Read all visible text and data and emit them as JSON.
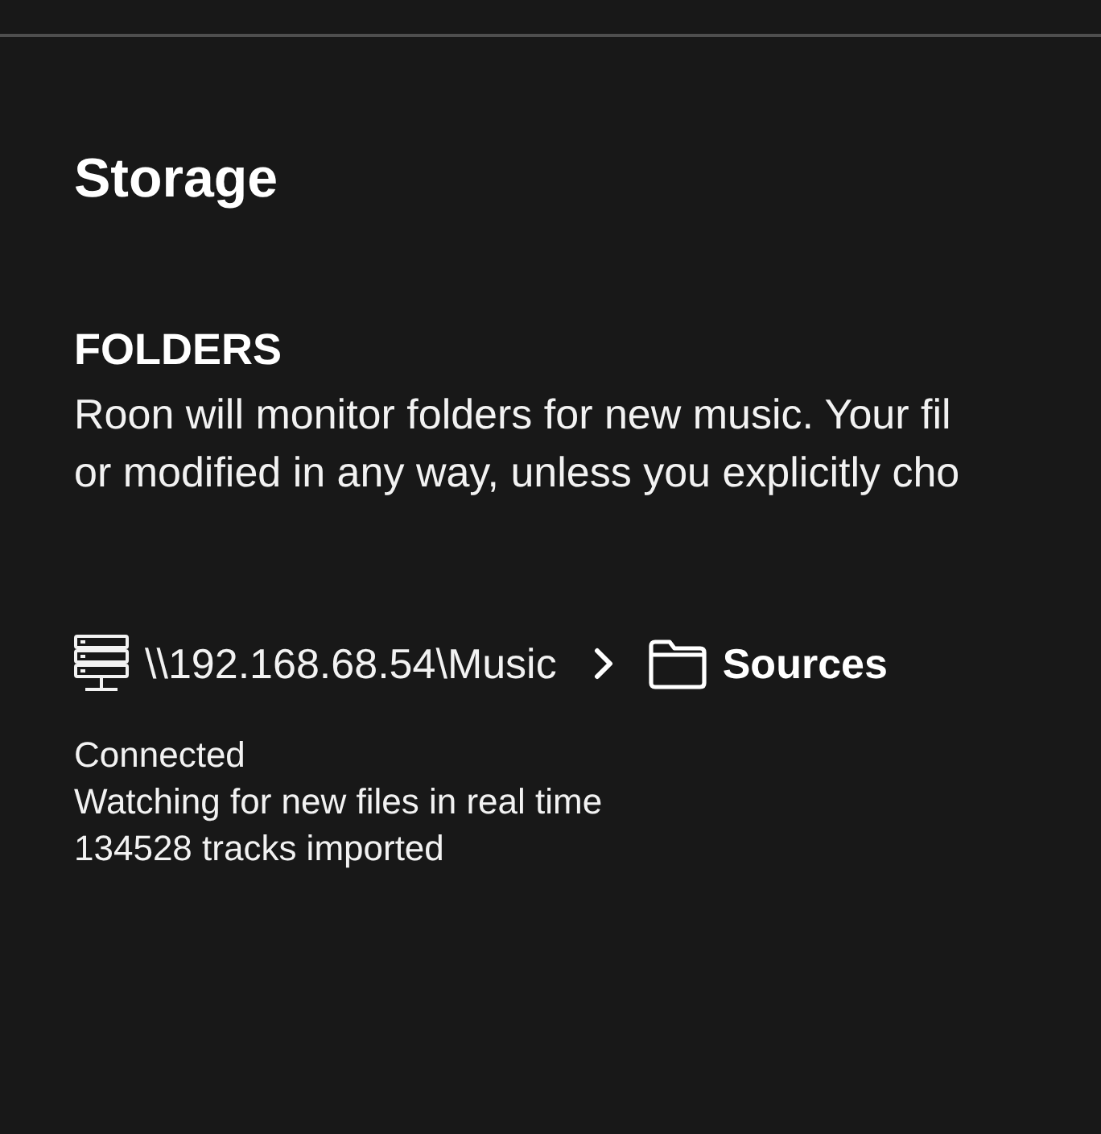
{
  "page": {
    "title": "Storage"
  },
  "folders_section": {
    "heading": "FOLDERS",
    "description_lines": [
      "Roon will monitor folders for new music. Your fil",
      "or modified in any way, unless you explicitly cho"
    ]
  },
  "folder": {
    "path": "\\\\192.168.68.54\\Music",
    "name": "Sources",
    "status_lines": [
      "Connected",
      "Watching for new files in real time",
      "134528 tracks imported"
    ]
  }
}
